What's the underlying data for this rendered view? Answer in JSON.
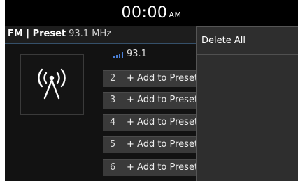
{
  "status": {
    "time": "00:00",
    "ampm": "AM"
  },
  "header": {
    "mode": "FM | Preset",
    "frequency": "93.1 MHz"
  },
  "current": {
    "frequency": "93.1",
    "signal_icon": "signal-bars-icon"
  },
  "art": {
    "icon": "radio-antenna-icon"
  },
  "presets": [
    {
      "number": "2",
      "label": "+ Add to Preset"
    },
    {
      "number": "3",
      "label": "+ Add to Preset"
    },
    {
      "number": "4",
      "label": "+ Add to Preset"
    },
    {
      "number": "5",
      "label": "+ Add to Preset"
    },
    {
      "number": "6",
      "label": "+ Add to Preset"
    }
  ],
  "menu": {
    "items": [
      {
        "label": "Delete All"
      }
    ]
  }
}
